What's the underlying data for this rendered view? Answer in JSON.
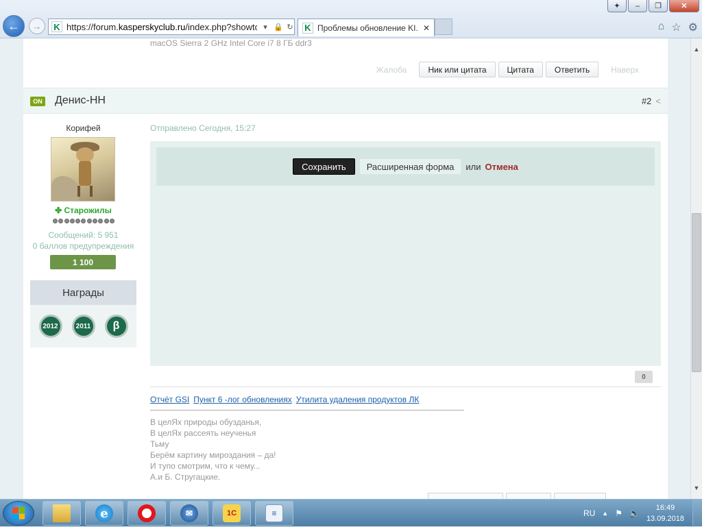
{
  "browser": {
    "url_prefix": "https://forum.",
    "url_domain": "kasperskyclub.ru",
    "url_rest": "/index.php?showtopic",
    "tab_title": "Проблемы обновление KI...",
    "tab_close": "✕",
    "addr_dropdown": "▾",
    "addr_lock": "🔒",
    "addr_refresh": "↻",
    "favicon_letter": "K",
    "back_glyph": "←",
    "fwd_glyph": "→",
    "win_min": "–",
    "win_max": "❐",
    "win_close": "✕",
    "tool_home": "⌂",
    "tool_star": "☆",
    "tool_gear": "⚙"
  },
  "prev_post": {
    "signature_line": "macOS Sierra 2 GHz Intel Core i7 8 ГБ ddr3",
    "report": "Жалоба",
    "nick_quote": "Ник или цитата",
    "quote": "Цитата",
    "reply": "Ответить",
    "to_top": "Наверх"
  },
  "post": {
    "online_badge": "ON",
    "author": "Денис-НН",
    "number": "#2",
    "share_glyph": "<",
    "rank": "Корифей",
    "group": "Старожилы",
    "messages": "Сообщений: 5 951",
    "warnings": "0 баллов предупреждения",
    "reputation": "1 100",
    "awards_title": "Награды",
    "awards": [
      "2012",
      "2011",
      "β"
    ],
    "sent": "Отправлено Сегодня, 15:27",
    "editor": {
      "save": "Сохранить",
      "advanced": "Расширенная форма",
      "or": "или",
      "cancel": "Отмена"
    },
    "likes": "0",
    "sig_links": [
      "Отчёт GSI",
      "Пункт 6 -лог обновлениях",
      "Утилита удаления продуктов ЛК"
    ],
    "poem": [
      "В целЯх природы обузданья,",
      "В целЯх рассеять неученья",
      "Тьму",
      "Берём картину мироздания – да!",
      "И тупо смотрим, что к чему...",
      "А.и Б. Стругацкие."
    ]
  },
  "scrollbar": {
    "up": "▲",
    "down": "▼"
  },
  "taskbar": {
    "apps": [
      "folder-icon",
      "ie-icon",
      "opera-icon",
      "thunderbird-icon",
      "1c-icon",
      "document-icon"
    ],
    "ie_glyph": "e",
    "c1_glyph": "1С",
    "lang": "RU",
    "time": "16:49",
    "date": "13.09.2018",
    "tray_up": "▲",
    "tray_flag": "⚑",
    "tray_sound": "🔈"
  }
}
